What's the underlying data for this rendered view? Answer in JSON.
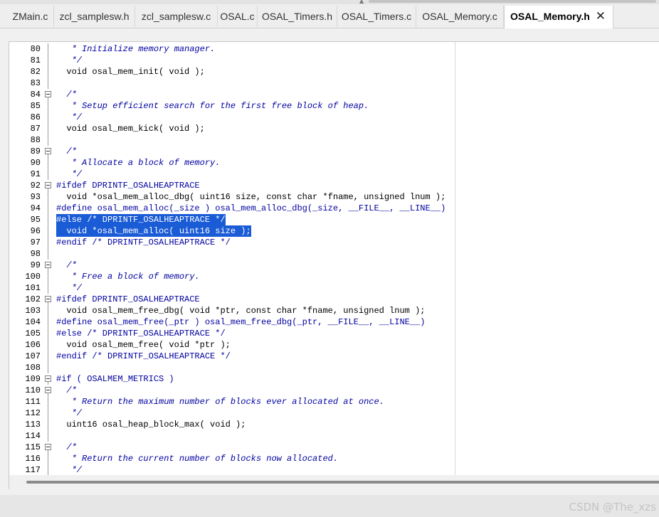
{
  "tabs": [
    {
      "label": "ZMain.c",
      "active": false
    },
    {
      "label": "zcl_samplesw.h",
      "active": false
    },
    {
      "label": "zcl_samplesw.c",
      "active": false
    },
    {
      "label": "OSAL.c",
      "active": false
    },
    {
      "label": "OSAL_Timers.h",
      "active": false
    },
    {
      "label": "OSAL_Timers.c",
      "active": false
    },
    {
      "label": "OSAL_Memory.c",
      "active": false
    },
    {
      "label": "OSAL_Memory.h",
      "active": true
    }
  ],
  "tab_close_glyph": "✕",
  "lines": [
    {
      "num": "80",
      "text": "   * Initialize memory manager.",
      "kind": "cmt",
      "fold": false
    },
    {
      "num": "81",
      "text": "   */",
      "kind": "cmt",
      "fold": false
    },
    {
      "num": "82",
      "text": "  void osal_mem_init( void );",
      "kind": "code",
      "fold": false
    },
    {
      "num": "83",
      "text": "",
      "kind": "code",
      "fold": false
    },
    {
      "num": "84",
      "text": "  /*",
      "kind": "cmt",
      "fold": true
    },
    {
      "num": "85",
      "text": "   * Setup efficient search for the first free block of heap.",
      "kind": "cmt",
      "fold": false
    },
    {
      "num": "86",
      "text": "   */",
      "kind": "cmt",
      "fold": false
    },
    {
      "num": "87",
      "text": "  void osal_mem_kick( void );",
      "kind": "code",
      "fold": false
    },
    {
      "num": "88",
      "text": "",
      "kind": "code",
      "fold": false
    },
    {
      "num": "89",
      "text": "  /*",
      "kind": "cmt",
      "fold": true
    },
    {
      "num": "90",
      "text": "   * Allocate a block of memory.",
      "kind": "cmt",
      "fold": false
    },
    {
      "num": "91",
      "text": "   */",
      "kind": "cmt",
      "fold": false
    },
    {
      "num": "92",
      "text": "#ifdef DPRINTF_OSALHEAPTRACE",
      "kind": "pre",
      "fold": true
    },
    {
      "num": "93",
      "text": "  void *osal_mem_alloc_dbg( uint16 size, const char *fname, unsigned lnum );",
      "kind": "code",
      "fold": false
    },
    {
      "num": "94",
      "text": "#define osal_mem_alloc(_size ) osal_mem_alloc_dbg(_size, __FILE__, __LINE__)",
      "kind": "pre",
      "fold": false
    },
    {
      "num": "95",
      "text": "#else /* DPRINTF_OSALHEAPTRACE */",
      "kind": "sel",
      "fold": false
    },
    {
      "num": "96",
      "text": "  void *osal_mem_alloc( uint16 size );",
      "kind": "sel",
      "fold": false
    },
    {
      "num": "97",
      "text": "#endif /* DPRINTF_OSALHEAPTRACE */",
      "kind": "pre",
      "fold": false
    },
    {
      "num": "98",
      "text": "",
      "kind": "code",
      "fold": false
    },
    {
      "num": "99",
      "text": "  /*",
      "kind": "cmt",
      "fold": true
    },
    {
      "num": "100",
      "text": "   * Free a block of memory.",
      "kind": "cmt",
      "fold": false
    },
    {
      "num": "101",
      "text": "   */",
      "kind": "cmt",
      "fold": false
    },
    {
      "num": "102",
      "text": "#ifdef DPRINTF_OSALHEAPTRACE",
      "kind": "pre",
      "fold": true
    },
    {
      "num": "103",
      "text": "  void osal_mem_free_dbg( void *ptr, const char *fname, unsigned lnum );",
      "kind": "code",
      "fold": false
    },
    {
      "num": "104",
      "text": "#define osal_mem_free(_ptr ) osal_mem_free_dbg(_ptr, __FILE__, __LINE__)",
      "kind": "pre",
      "fold": false
    },
    {
      "num": "105",
      "text": "#else /* DPRINTF_OSALHEAPTRACE */",
      "kind": "pre",
      "fold": false
    },
    {
      "num": "106",
      "text": "  void osal_mem_free( void *ptr );",
      "kind": "code",
      "fold": false
    },
    {
      "num": "107",
      "text": "#endif /* DPRINTF_OSALHEAPTRACE */",
      "kind": "pre",
      "fold": false
    },
    {
      "num": "108",
      "text": "",
      "kind": "code",
      "fold": false
    },
    {
      "num": "109",
      "text": "#if ( OSALMEM_METRICS )",
      "kind": "pre",
      "fold": true
    },
    {
      "num": "110",
      "text": "  /*",
      "kind": "cmt",
      "fold": true
    },
    {
      "num": "111",
      "text": "   * Return the maximum number of blocks ever allocated at once.",
      "kind": "cmt",
      "fold": false
    },
    {
      "num": "112",
      "text": "   */",
      "kind": "cmt",
      "fold": false
    },
    {
      "num": "113",
      "text": "  uint16 osal_heap_block_max( void );",
      "kind": "code",
      "fold": false
    },
    {
      "num": "114",
      "text": "",
      "kind": "code",
      "fold": false
    },
    {
      "num": "115",
      "text": "  /*",
      "kind": "cmt",
      "fold": true
    },
    {
      "num": "116",
      "text": "   * Return the current number of blocks now allocated.",
      "kind": "cmt",
      "fold": false
    },
    {
      "num": "117",
      "text": "   */",
      "kind": "cmt",
      "fold": false
    }
  ],
  "watermark": "CSDN @The_xzs"
}
